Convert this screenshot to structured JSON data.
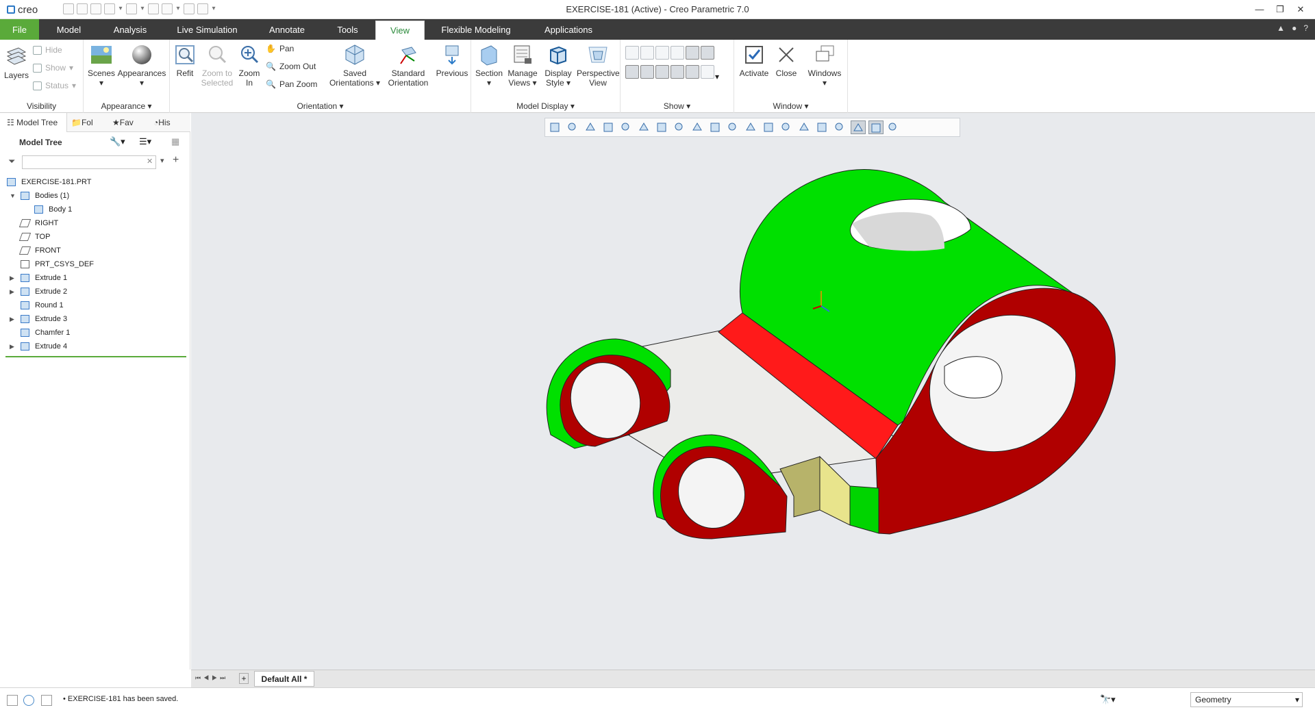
{
  "app": {
    "logo_text": "creo",
    "window_title": "EXERCISE-181 (Active) - Creo Parametric 7.0"
  },
  "tabs": [
    {
      "label": "File"
    },
    {
      "label": "Model"
    },
    {
      "label": "Analysis"
    },
    {
      "label": "Live Simulation"
    },
    {
      "label": "Annotate"
    },
    {
      "label": "Tools"
    },
    {
      "label": "View"
    },
    {
      "label": "Flexible Modeling"
    },
    {
      "label": "Applications"
    }
  ],
  "ribbon": {
    "visibility": {
      "label": "Visibility",
      "layers": "Layers",
      "hide": "Hide",
      "show": "Show",
      "status": "Status"
    },
    "appearance": {
      "label": "Appearance",
      "scenes": "Scenes",
      "appearances": "Appearances"
    },
    "orientation": {
      "label": "Orientation",
      "refit": "Refit",
      "zoom_to_selected": "Zoom to Selected",
      "zoom_in": "Zoom In",
      "pan": "Pan",
      "zoom_out": "Zoom Out",
      "pan_zoom": "Pan Zoom",
      "saved_orientations": "Saved Orientations",
      "standard_orientation": "Standard Orientation",
      "previous": "Previous"
    },
    "model_display": {
      "label": "Model Display",
      "section": "Section",
      "manage_views": "Manage Views",
      "display_style": "Display Style",
      "perspective_view": "Perspective View"
    },
    "show": {
      "label": "Show"
    },
    "window": {
      "label": "Window",
      "activate": "Activate",
      "close": "Close",
      "windows": "Windows"
    }
  },
  "nav_tabs": {
    "model_tree": "Model Tree",
    "folder": "Fol",
    "favorites": "Fav",
    "history": "His"
  },
  "model_tree": {
    "title": "Model Tree",
    "search_placeholder": "",
    "items": [
      {
        "label": "EXERCISE-181.PRT",
        "icon": "part-icon",
        "level": 0,
        "expander": ""
      },
      {
        "label": "Bodies (1)",
        "icon": "bodies-icon",
        "level": 1,
        "expander": "▼"
      },
      {
        "label": "Body 1",
        "icon": "body-icon",
        "level": 2,
        "expander": ""
      },
      {
        "label": "RIGHT",
        "icon": "datum-plane-icon",
        "level": 1,
        "expander": ""
      },
      {
        "label": "TOP",
        "icon": "datum-plane-icon",
        "level": 1,
        "expander": ""
      },
      {
        "label": "FRONT",
        "icon": "datum-plane-icon",
        "level": 1,
        "expander": ""
      },
      {
        "label": "PRT_CSYS_DEF",
        "icon": "csys-icon",
        "level": 1,
        "expander": ""
      },
      {
        "label": "Extrude 1",
        "icon": "extrude-icon",
        "level": 1,
        "expander": "▶"
      },
      {
        "label": "Extrude 2",
        "icon": "extrude-icon",
        "level": 1,
        "expander": "▶"
      },
      {
        "label": "Round 1",
        "icon": "round-icon",
        "level": 1,
        "expander": ""
      },
      {
        "label": "Extrude 3",
        "icon": "extrude-icon",
        "level": 1,
        "expander": "▶"
      },
      {
        "label": "Chamfer 1",
        "icon": "chamfer-icon",
        "level": 1,
        "expander": ""
      },
      {
        "label": "Extrude 4",
        "icon": "extrude-icon",
        "level": 1,
        "expander": "▶"
      }
    ]
  },
  "bottom_tab": {
    "label": "Default All *"
  },
  "status": {
    "message": "EXERCISE-181 has been saved.",
    "filter_value": "Geometry"
  },
  "colors": {
    "accent_green": "#5aaa3a",
    "model_green": "#00e000",
    "model_red": "#b00000",
    "highlight_red": "#ff1a1a",
    "cut_face": "#b7b36a",
    "cut_face_light": "#e8e48c"
  }
}
